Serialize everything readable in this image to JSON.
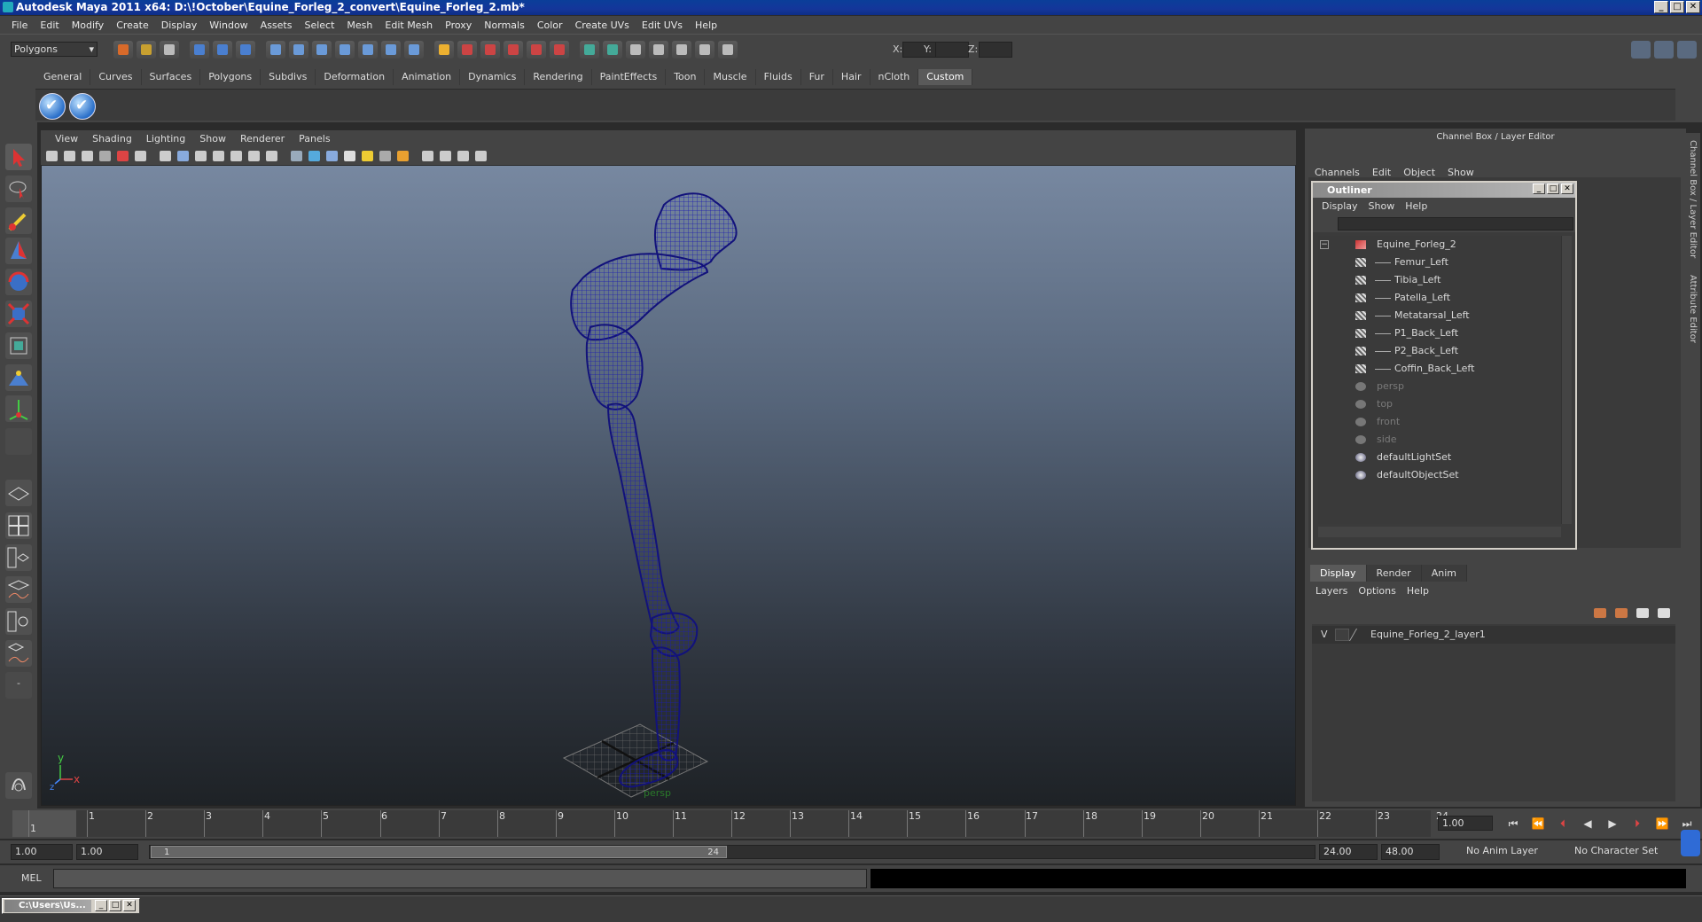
{
  "window": {
    "title": "Autodesk Maya 2011 x64: D:\\!October\\Equine_Forleg_2_convert\\Equine_Forleg_2.mb*",
    "min": "_",
    "max": "□",
    "close": "✕"
  },
  "menubar": [
    "File",
    "Edit",
    "Modify",
    "Create",
    "Display",
    "Window",
    "Assets",
    "Select",
    "Mesh",
    "Edit Mesh",
    "Proxy",
    "Normals",
    "Color",
    "Create UVs",
    "Edit UVs",
    "Help"
  ],
  "status": {
    "module": "Polygons",
    "coord_x": "X:",
    "coord_y": "Y:",
    "coord_z": "Z:"
  },
  "shelf": {
    "tabs": [
      "General",
      "Curves",
      "Surfaces",
      "Polygons",
      "Subdivs",
      "Deformation",
      "Animation",
      "Dynamics",
      "Rendering",
      "PaintEffects",
      "Toon",
      "Muscle",
      "Fluids",
      "Fur",
      "Hair",
      "nCloth",
      "Custom"
    ],
    "active": "Custom"
  },
  "viewport": {
    "menu": [
      "View",
      "Shading",
      "Lighting",
      "Show",
      "Renderer",
      "Panels"
    ],
    "camera_label": "persp",
    "axis_y": "y",
    "axis_x": "x",
    "axis_z": "z",
    "wire_color": "#12127a"
  },
  "channelbox": {
    "title": "Channel Box / Layer Editor",
    "menu": [
      "Channels",
      "Edit",
      "Object",
      "Show"
    ]
  },
  "outliner": {
    "title": "Outliner",
    "menu": [
      "Display",
      "Show",
      "Help"
    ],
    "items": [
      {
        "label": "Equine_Forleg_2",
        "type": "group"
      },
      {
        "label": "Femur_Left",
        "type": "mesh"
      },
      {
        "label": "Tibia_Left",
        "type": "mesh"
      },
      {
        "label": "Patella_Left",
        "type": "mesh"
      },
      {
        "label": "Metatarsal_Left",
        "type": "mesh"
      },
      {
        "label": "P1_Back_Left",
        "type": "mesh"
      },
      {
        "label": "P2_Back_Left",
        "type": "mesh"
      },
      {
        "label": "Coffin_Back_Left",
        "type": "mesh"
      },
      {
        "label": "persp",
        "type": "camera"
      },
      {
        "label": "top",
        "type": "camera"
      },
      {
        "label": "front",
        "type": "camera"
      },
      {
        "label": "side",
        "type": "camera"
      },
      {
        "label": "defaultLightSet",
        "type": "set"
      },
      {
        "label": "defaultObjectSet",
        "type": "set"
      }
    ]
  },
  "layers": {
    "tabs": [
      "Display",
      "Render",
      "Anim"
    ],
    "active": "Display",
    "menu": [
      "Layers",
      "Options",
      "Help"
    ],
    "rows": [
      {
        "visible": "V",
        "name": "Equine_Forleg_2_layer1"
      }
    ]
  },
  "timeline": {
    "ticks": [
      "1",
      "2",
      "3",
      "4",
      "5",
      "6",
      "7",
      "8",
      "9",
      "10",
      "11",
      "12",
      "13",
      "14",
      "15",
      "16",
      "17",
      "18",
      "19",
      "20",
      "21",
      "22",
      "23",
      "24"
    ],
    "current_frame": "1.00",
    "marker": "1"
  },
  "range": {
    "start": "1.00",
    "playback_start": "1.00",
    "slider_start": "1",
    "slider_end": "24",
    "playback_end": "24.00",
    "end": "48.00",
    "anim_layer": "No Anim Layer",
    "character_set": "No Character Set"
  },
  "cmd": {
    "label": "MEL"
  },
  "taskbar": {
    "minimized": "C:\\Users\\Us..."
  },
  "side": {
    "channel_tab": "Channel Box / Layer Editor",
    "attr_tab": "Attribute Editor"
  }
}
